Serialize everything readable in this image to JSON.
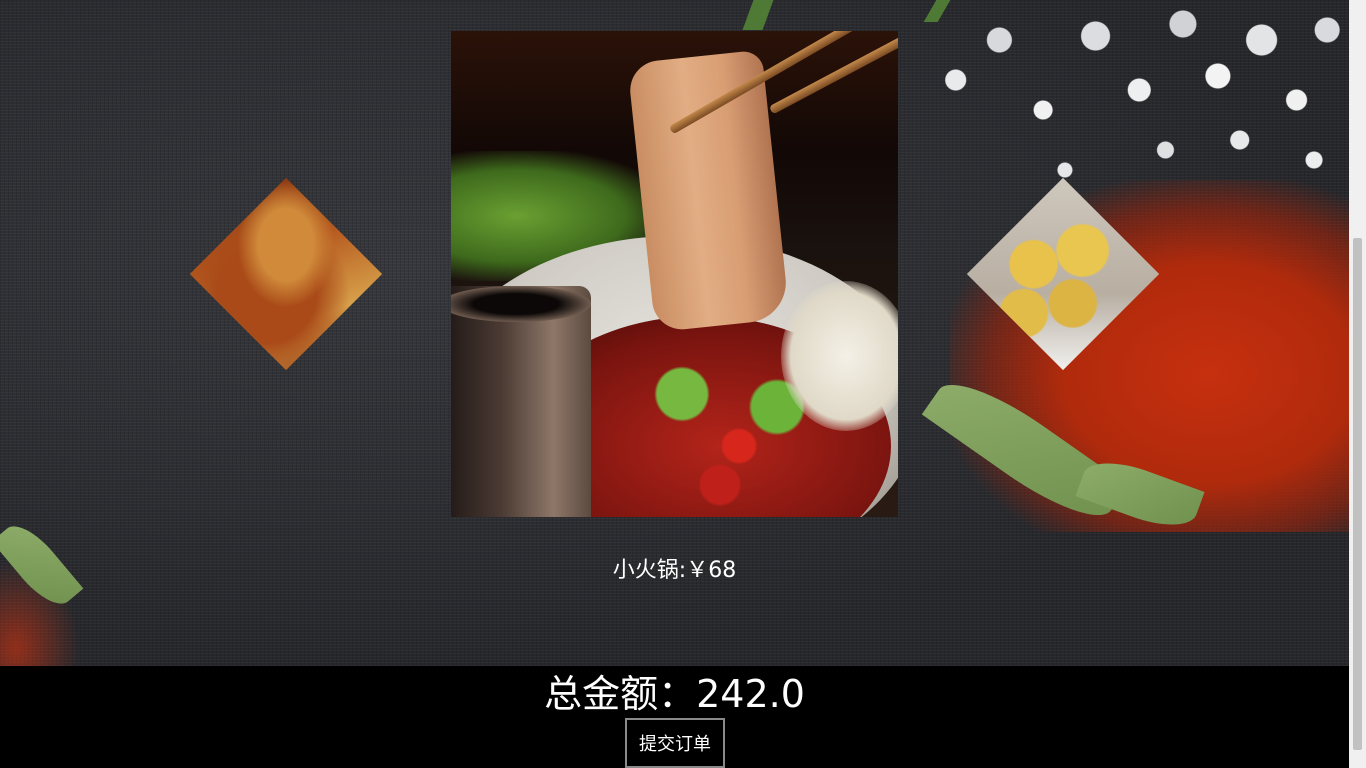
{
  "product": {
    "name_price": "小火锅:￥68"
  },
  "thumbnails": [
    {
      "name": "grilled-eel-thumbnail"
    },
    {
      "name": "fish-balls-thumbnail"
    }
  ],
  "summary": {
    "total_text": "总金额：242.0",
    "submit_label": "提交订单"
  },
  "colors": {
    "background": "#2c2d31",
    "summary_bar": "#000000",
    "text": "#ffffff",
    "chili": "#c6300f"
  }
}
